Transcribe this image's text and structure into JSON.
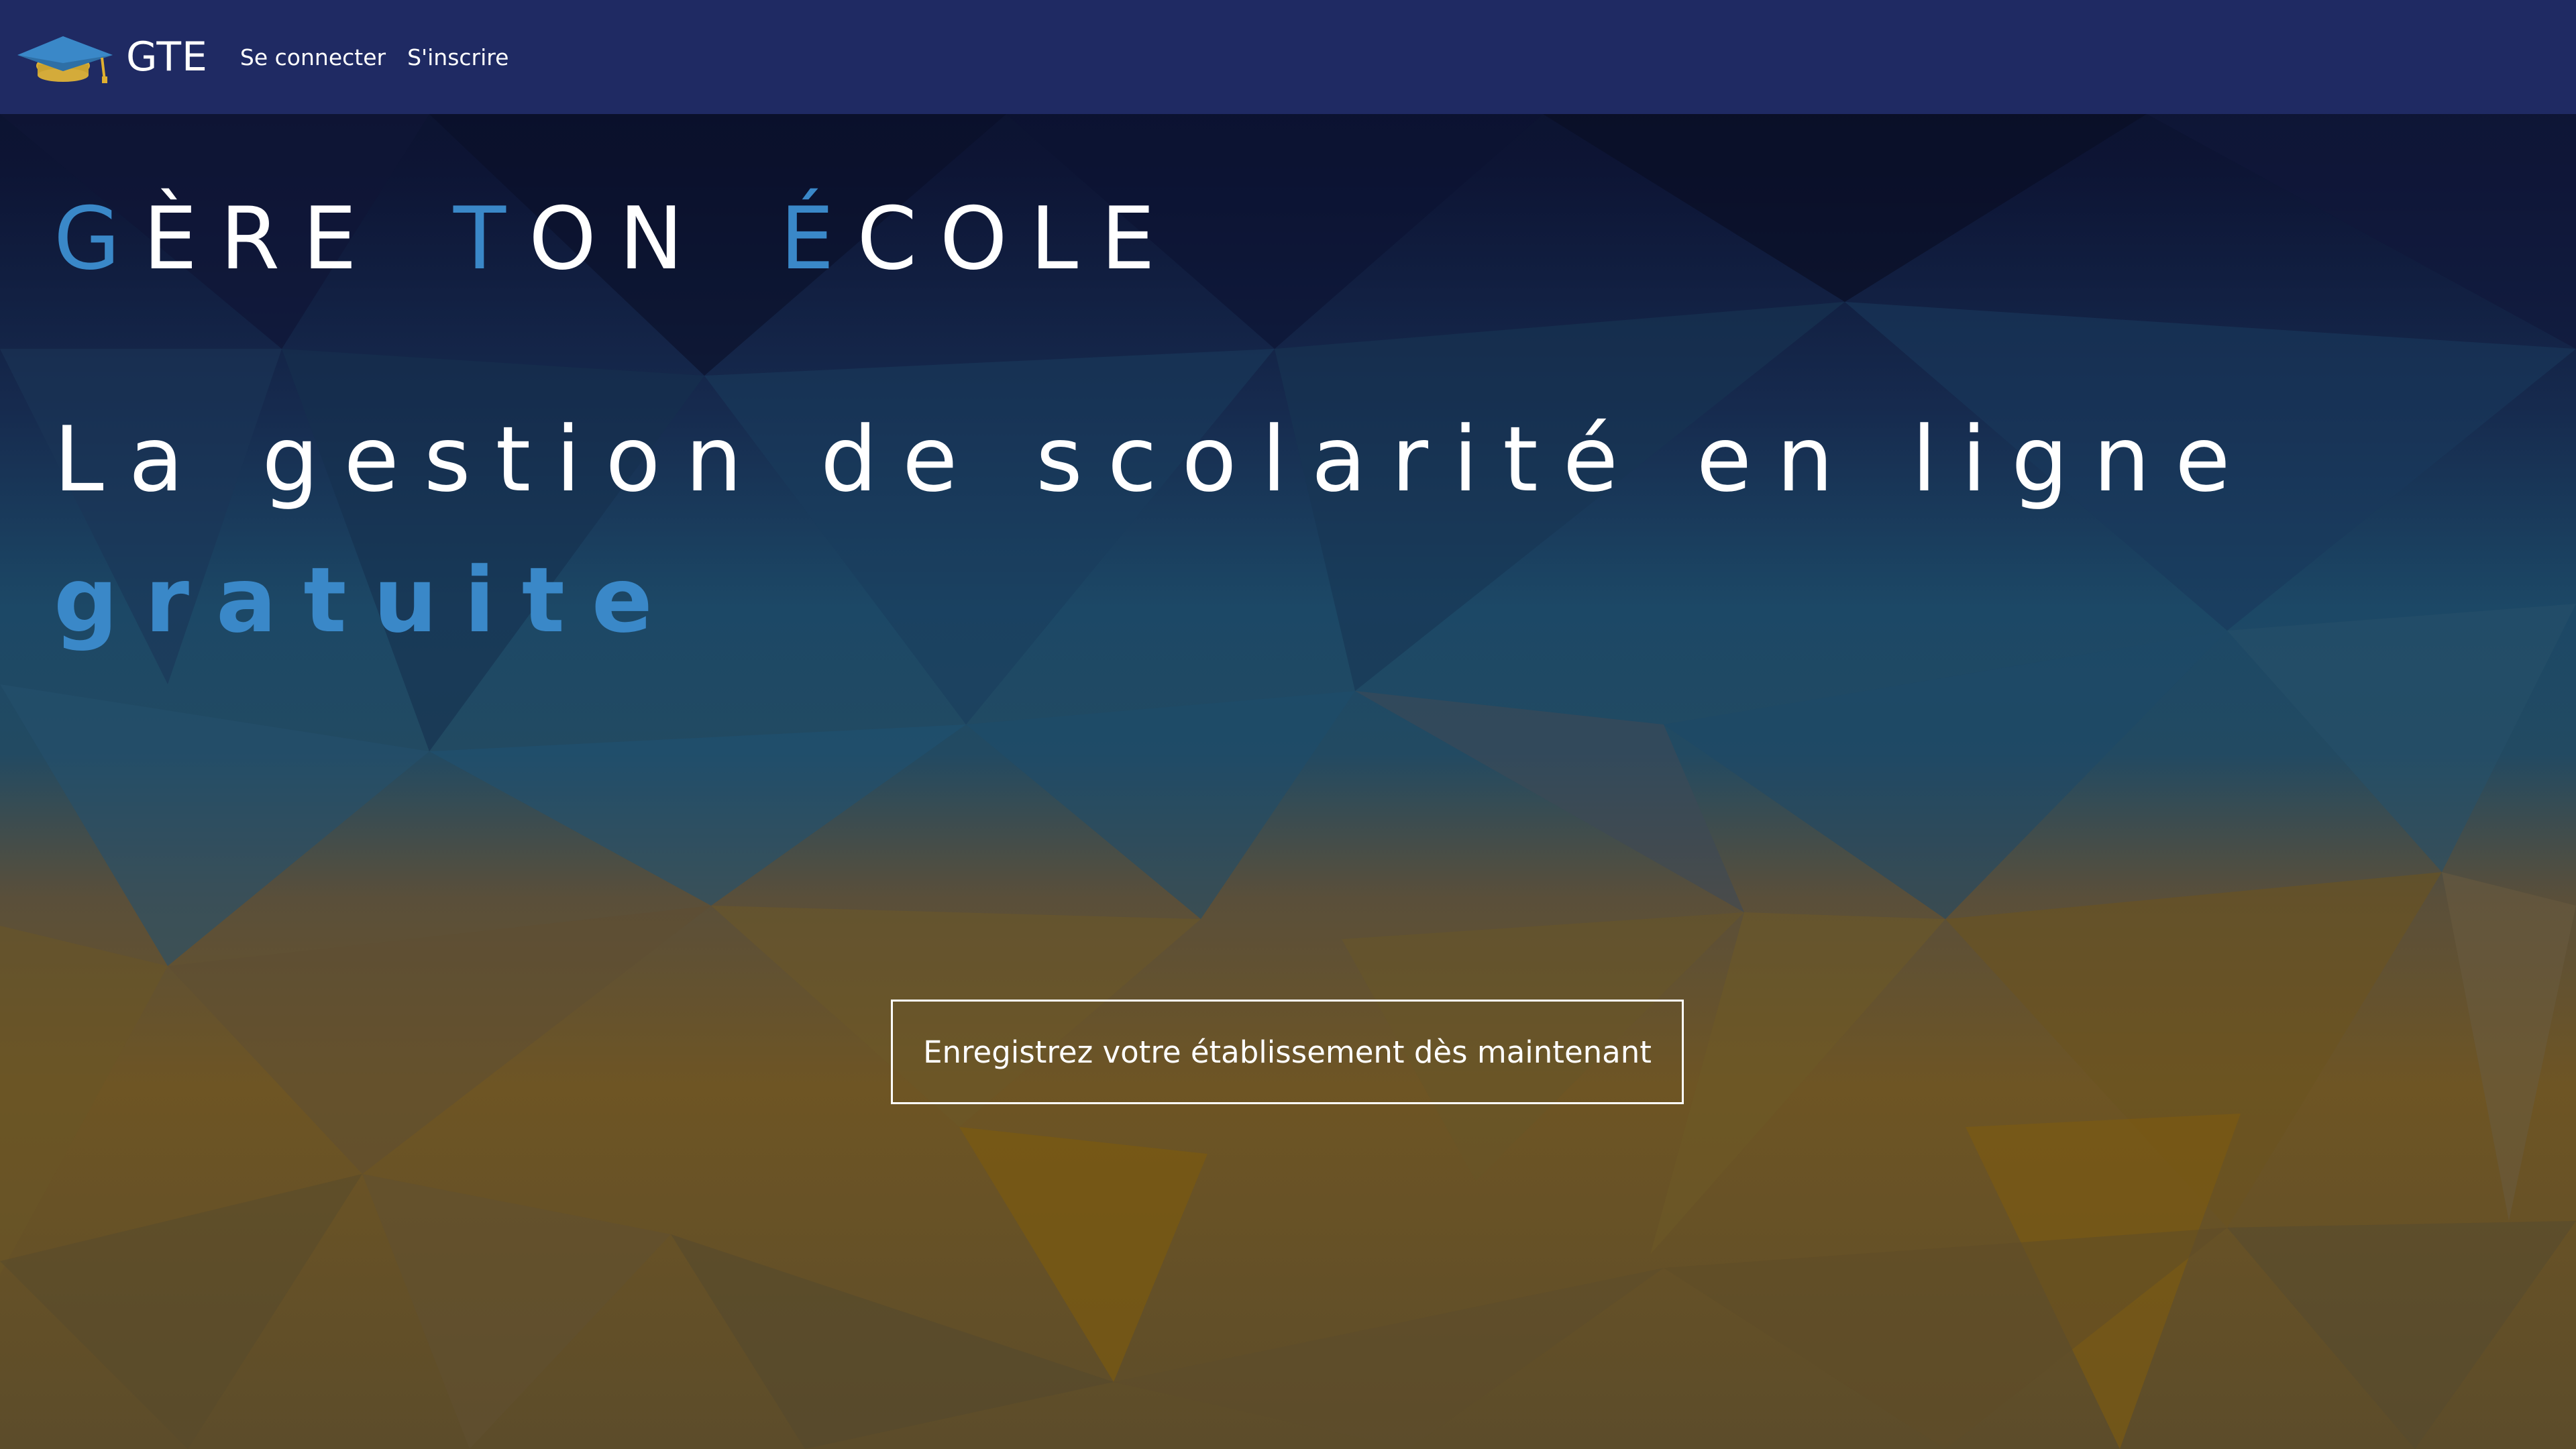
{
  "colors": {
    "navbar_bg": "#1f2a63",
    "accent_blue": "#3a88c8",
    "text": "#ffffff",
    "background_top": "#0c1230",
    "background_mid": "#1c4a6b",
    "background_bottom": "#7a5a18"
  },
  "navbar": {
    "logo_icon": "graduation-cap-icon",
    "brand": "GTE",
    "links": {
      "login": "Se connecter",
      "signup": "S'inscrire"
    }
  },
  "hero": {
    "title": {
      "word1_initial": "G",
      "word1_rest": "ÈRE",
      "word2_initial": "T",
      "word2_rest": "ON",
      "word3_initial": "É",
      "word3_rest": "COLE"
    },
    "subtitle_line1": "La gestion de scolarité en ligne",
    "subtitle_line2": "gratuite",
    "cta_label": "Enregistrez votre établissement dès maintenant"
  }
}
